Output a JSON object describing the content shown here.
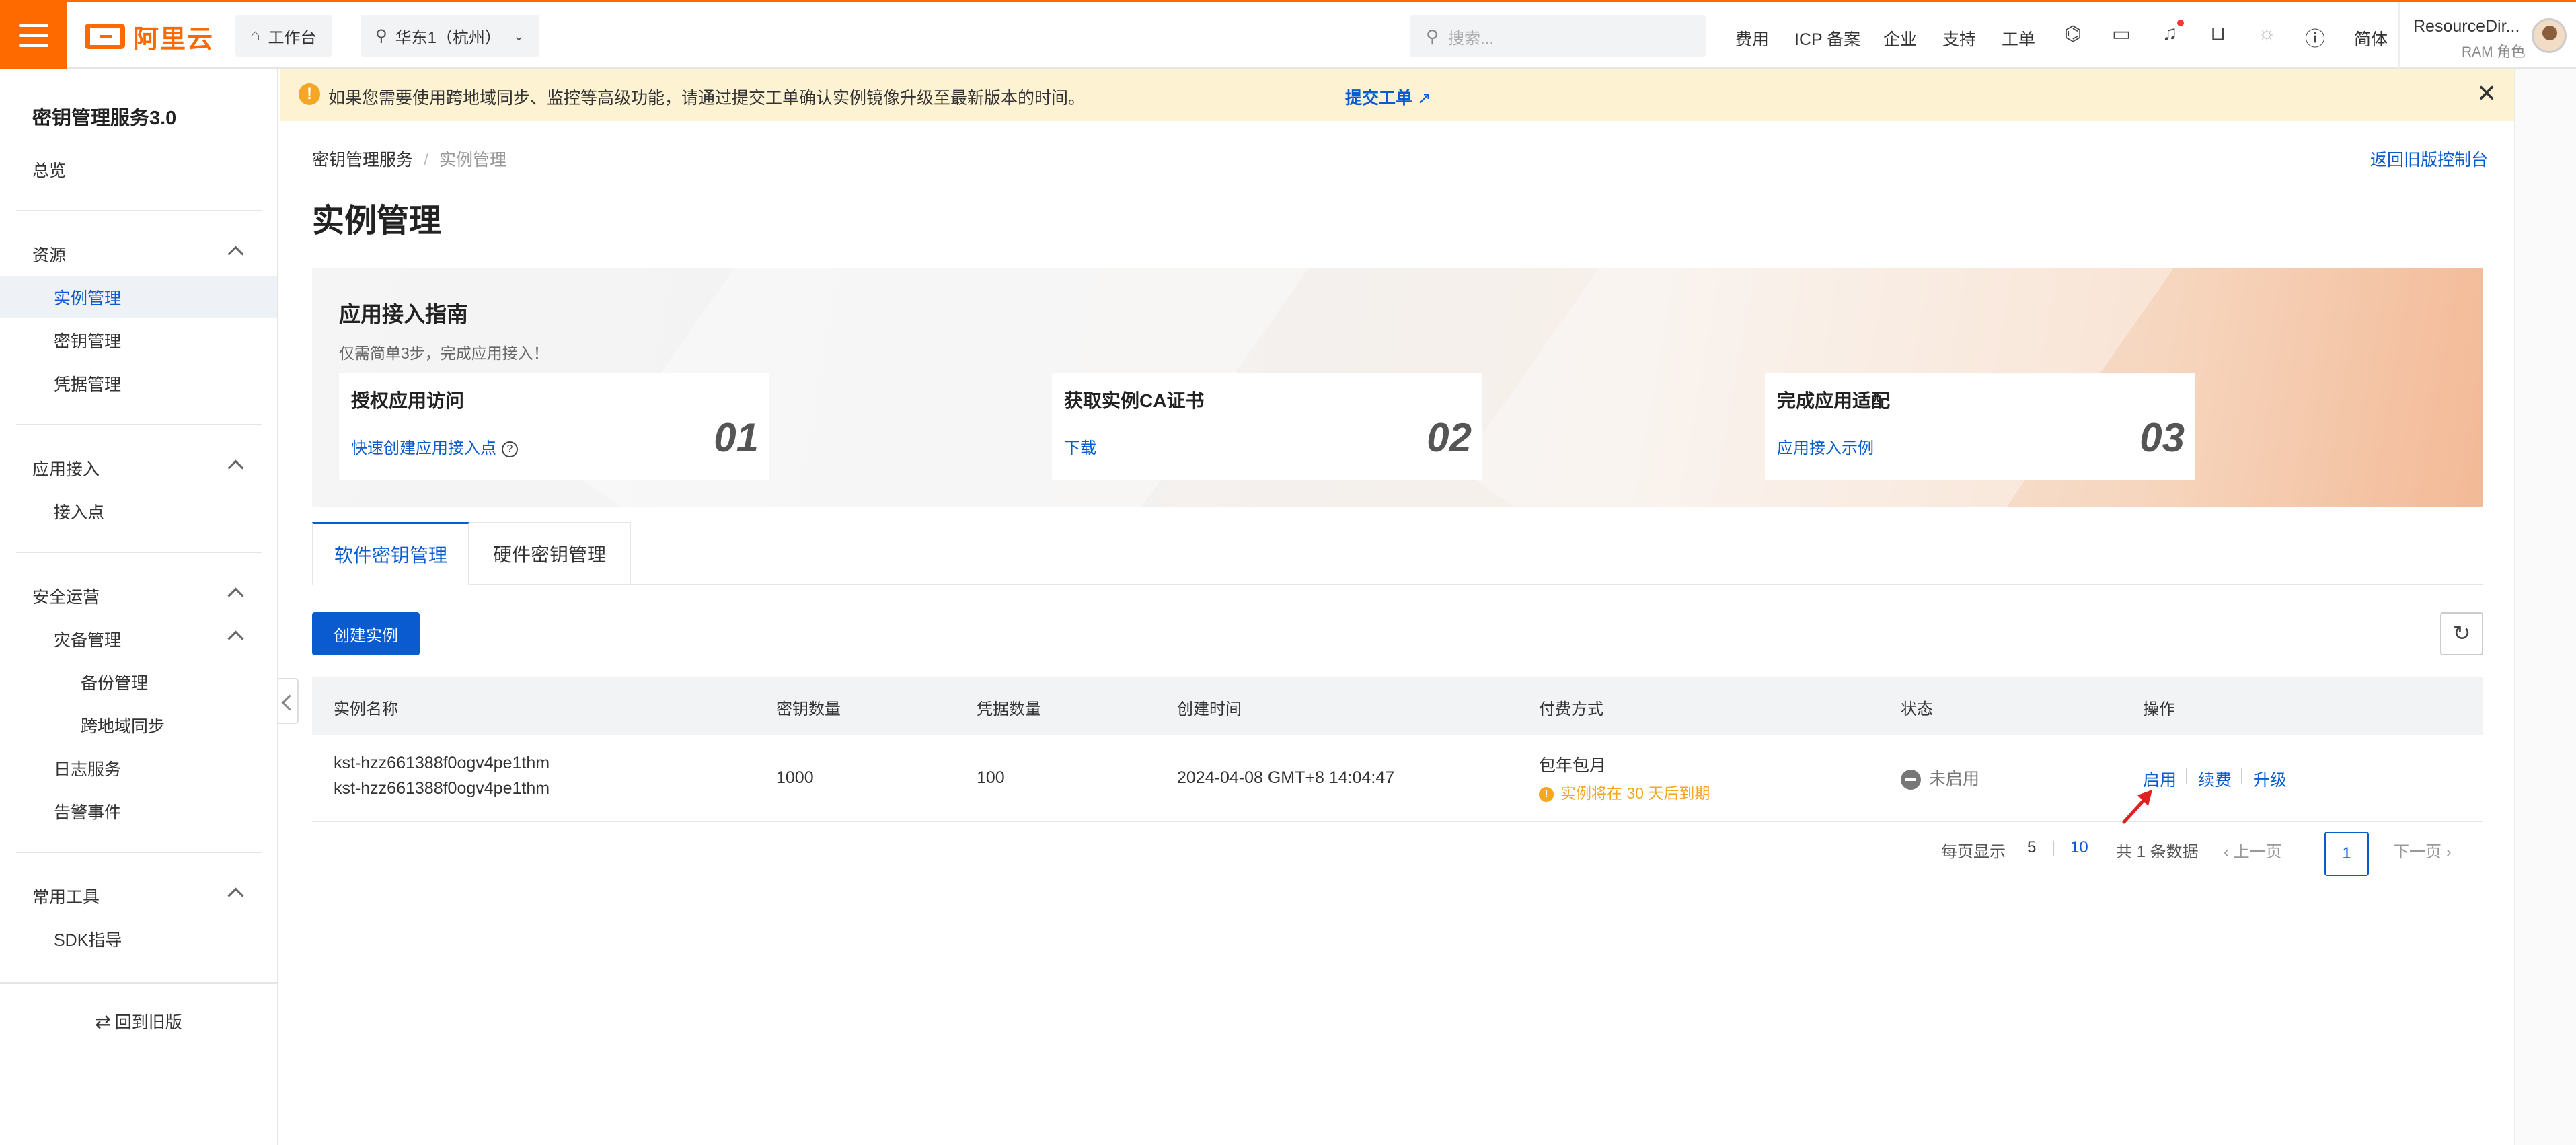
{
  "header": {
    "logo_text": "阿里云",
    "workbench": "工作台",
    "region": "华东1（杭州）",
    "search_placeholder": "搜索...",
    "nav": [
      "费用",
      "ICP 备案",
      "企业",
      "支持",
      "工单"
    ],
    "lang": "简体",
    "user_name": "ResourceDir...",
    "user_role": "RAM 角色"
  },
  "sidebar": {
    "title": "密钥管理服务3.0",
    "overview": "总览",
    "groups": {
      "resources": "资源",
      "app_access": "应用接入",
      "security_ops": "安全运营",
      "tools": "常用工具"
    },
    "items": {
      "instance_mgmt": "实例管理",
      "key_mgmt": "密钥管理",
      "credential_mgmt": "凭据管理",
      "endpoint": "接入点",
      "disaster": "灾备管理",
      "backup": "备份管理",
      "cross_region": "跨地域同步",
      "log_service": "日志服务",
      "alert_events": "告警事件",
      "sdk": "SDK指导"
    },
    "back_old": "回到旧版"
  },
  "notice": {
    "text": "如果您需要使用跨地域同步、监控等高级功能，请通过提交工单确认实例镜像升级至最新版本的时间。",
    "link": "提交工单"
  },
  "breadcrumb": {
    "root": "密钥管理服务",
    "current": "实例管理"
  },
  "back_old_console": "返回旧版控制台",
  "page_title": "实例管理",
  "guide": {
    "title": "应用接入指南",
    "subtitle": "仅需简单3步，完成应用接入！",
    "cards": [
      {
        "title": "授权应用访问",
        "link": "快速创建应用接入点",
        "num": "01"
      },
      {
        "title": "获取实例CA证书",
        "link": "下载",
        "num": "02"
      },
      {
        "title": "完成应用适配",
        "link": "应用接入示例",
        "num": "03"
      }
    ]
  },
  "tabs": {
    "software": "软件密钥管理",
    "hardware": "硬件密钥管理"
  },
  "create_button": "创建实例",
  "table": {
    "headers": [
      "实例名称",
      "密钥数量",
      "凭据数量",
      "创建时间",
      "付费方式",
      "状态",
      "操作"
    ],
    "rows": [
      {
        "name_line1": "kst-hzz661388f0ogv4pe1thm",
        "name_line2": "kst-hzz661388f0ogv4pe1thm",
        "keys": "1000",
        "credentials": "100",
        "created": "2024-04-08 GMT+8 14:04:47",
        "billing": "包年包月",
        "expiry_warning": "实例将在 30 天后到期",
        "status": "未启用",
        "actions": [
          "启用",
          "续费",
          "升级"
        ]
      }
    ]
  },
  "pagination": {
    "per_page_label": "每页显示",
    "opt5": "5",
    "opt10": "10",
    "total": "共 1 条数据",
    "prev": "上一页",
    "current": "1",
    "next": "下一页"
  },
  "colors": {
    "accent": "#0a5bd0",
    "brand": "#ff6a00",
    "warning": "#f5a623"
  }
}
